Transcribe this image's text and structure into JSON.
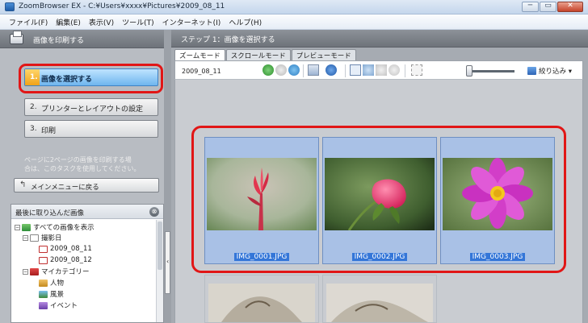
{
  "window": {
    "title": "ZoomBrowser EX  -  C:¥Users¥xxxx¥Pictures¥2009_08_11",
    "buttons": [
      "─",
      "▭",
      "✕"
    ]
  },
  "menu": [
    "ファイル(F)",
    "編集(E)",
    "表示(V)",
    "ツール(T)",
    "インターネット(I)",
    "ヘルプ(H)"
  ],
  "left_panel": {
    "header": "画像を印刷する",
    "steps": [
      {
        "num": "1.",
        "label": "画像を選択する",
        "active": true
      },
      {
        "num": "2.",
        "label": "プリンターとレイアウトの設定",
        "active": false
      },
      {
        "num": "3.",
        "label": "印刷",
        "active": false
      }
    ],
    "tip_line1": "ページに2ページの画像を印刷する場",
    "tip_line2": "合は、このタスクを使用してください。",
    "back_button": "メインメニューに戻る"
  },
  "tree": {
    "header": "最後に取り込んだ画像",
    "collapse_symbol": "⊗",
    "rows": [
      {
        "indent": 0,
        "expander": "−",
        "icon": "all",
        "label": "すべての画像を表示"
      },
      {
        "indent": 1,
        "expander": "−",
        "icon": "calendar",
        "label": "撮影日"
      },
      {
        "indent": 2,
        "expander": "",
        "icon": "calendar-day",
        "label": "2009_08_11"
      },
      {
        "indent": 2,
        "expander": "",
        "icon": "calendar-day",
        "label": "2009_08_12"
      },
      {
        "indent": 1,
        "expander": "−",
        "icon": "category",
        "label": "マイカテゴリー"
      },
      {
        "indent": 2,
        "expander": "",
        "icon": "people",
        "label": "人物"
      },
      {
        "indent": 2,
        "expander": "",
        "icon": "landscape",
        "label": "風景"
      },
      {
        "indent": 2,
        "expander": "",
        "icon": "event",
        "label": "イベント"
      }
    ]
  },
  "right_panel": {
    "header": "ステップ 1：画像を選択する",
    "tabs": [
      "ズームモード",
      "スクロールモード",
      "プレビューモード"
    ],
    "folder_date": "2009_08_11",
    "filter_label": "絞り込み ▾"
  },
  "thumbnails": [
    {
      "file": "IMG_0001.JPG"
    },
    {
      "file": "IMG_0002.JPG"
    },
    {
      "file": "IMG_0003.JPG"
    }
  ],
  "colors": {
    "highlight": "#e11616",
    "selection_label": "#3476d8",
    "active_step": "#6fb5ee"
  }
}
